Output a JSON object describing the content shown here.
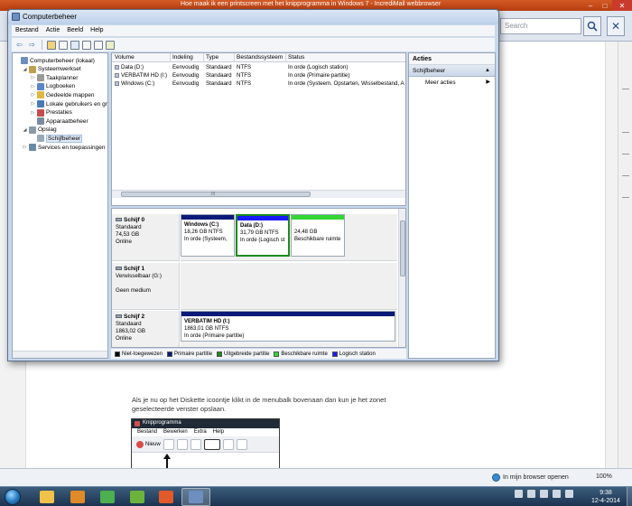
{
  "browser": {
    "title": "Hoe maak ik een printscreen met het knipprogramma in Windows 7 - IncrediMail webbrowser",
    "search_placeholder": "Search",
    "article_text": "Als je nu op het Diskette icoontje klikt in de menubalk bovenaan dan kun je het zonet geselecteerde venster opslaan.",
    "paint_window": {
      "title": "Knipprogramma",
      "menu": [
        "Bestand",
        "Bewerken",
        "Extra",
        "Help"
      ],
      "new_label": "Nieuw"
    },
    "status": {
      "protected_mode": "In mijn browser openen",
      "zoom": "100%"
    }
  },
  "taskbar": {
    "apps": [
      {
        "name": "explorer",
        "color": "#f0c24a"
      },
      {
        "name": "media-player",
        "color": "#e08a2a"
      },
      {
        "name": "chrome",
        "color": "#4caf50"
      },
      {
        "name": "utorrent",
        "color": "#6cb33e"
      },
      {
        "name": "incredimail",
        "color": "#e05a2a"
      },
      {
        "name": "computer-management",
        "color": "#6c8fbf"
      }
    ],
    "clock_time": "9:38",
    "clock_date": "12-4-2014"
  },
  "cm": {
    "title": "Computerbeheer",
    "menu": [
      "Bestand",
      "Actie",
      "Beeld",
      "Help"
    ],
    "tree": [
      {
        "label": "Computerbeheer (lokaal)",
        "indent": 0,
        "exp": "",
        "color": "#6c8fbf"
      },
      {
        "label": "Systeemwerkset",
        "indent": 1,
        "exp": "◢",
        "color": "#c0a050"
      },
      {
        "label": "Taakplanner",
        "indent": 2,
        "exp": "▷",
        "color": "#9a9a9a"
      },
      {
        "label": "Logboeken",
        "indent": 2,
        "exp": "▷",
        "color": "#5a86c8"
      },
      {
        "label": "Gedeelde mappen",
        "indent": 2,
        "exp": "▷",
        "color": "#e0b840"
      },
      {
        "label": "Lokale gebruikers en gr",
        "indent": 2,
        "exp": "▷",
        "color": "#4a7ab8"
      },
      {
        "label": "Prestaties",
        "indent": 2,
        "exp": "▷",
        "color": "#c84a4a"
      },
      {
        "label": "Apparaatbeheer",
        "indent": 2,
        "exp": "",
        "color": "#7a8aa0"
      },
      {
        "label": "Opslag",
        "indent": 1,
        "exp": "◢",
        "color": "#8a9aaa"
      },
      {
        "label": "Schijfbeheer",
        "indent": 2,
        "exp": "",
        "color": "#9aaabb",
        "selected": true
      },
      {
        "label": "Services en toepassingen",
        "indent": 1,
        "exp": "▷",
        "color": "#6a8aa8"
      }
    ],
    "volume_columns": [
      "Volume",
      "Indeling",
      "Type",
      "Bestandssysteem",
      "Status"
    ],
    "volumes": [
      [
        "Data (D:)",
        "Eenvoudig",
        "Standaard",
        "NTFS",
        "In orde (Logisch station)"
      ],
      [
        "VERBATIM HD (I:)",
        "Eenvoudig",
        "Standaard",
        "NTFS",
        "In orde (Primaire partitie)"
      ],
      [
        "Windows (C:)",
        "Eenvoudig",
        "Standaard",
        "NTFS",
        "In orde (Systeem, Opstarten, Wisselbestand, A"
      ]
    ],
    "disks": [
      {
        "name": "Schijf 0",
        "lines": [
          "Standaard",
          "74,53 GB",
          "Online"
        ],
        "partitions": [
          {
            "title": "Windows (C:)",
            "lines": [
              "18,26 GB NTFS",
              "In orde (Systeem,"
            ],
            "color": "#0a1a78"
          },
          {
            "title": "Data (D:)",
            "lines": [
              "31,79 GB NTFS",
              "In orde (Logisch st"
            ],
            "color": "#1a1aff",
            "highlight": true
          },
          {
            "title": "",
            "lines": [
              "24,48 GB",
              "Beschikbare ruimte"
            ],
            "color": "#33d633"
          }
        ]
      },
      {
        "name": "Schijf 1",
        "lines": [
          "Verwisselbaar (G:)",
          "",
          "Geen medium"
        ],
        "partitions": []
      },
      {
        "name": "Schijf 2",
        "lines": [
          "Standaard",
          "1863,02 GB",
          "Online"
        ],
        "partitions": [
          {
            "title": "VERBATIM HD (I:)",
            "lines": [
              "1863,01 GB NTFS",
              "In orde (Primaire partitie)"
            ],
            "color": "#0a1a78"
          }
        ]
      }
    ],
    "legend": [
      {
        "label": "Niet-toegewezen",
        "color": "#000000"
      },
      {
        "label": "Primaire partitie",
        "color": "#0a1a78"
      },
      {
        "label": "Uitgebreide partitie",
        "color": "#1e8a1e"
      },
      {
        "label": "Beschikbare ruimte",
        "color": "#33d633"
      },
      {
        "label": "Logisch station",
        "color": "#1a1aff"
      }
    ],
    "actions": {
      "header": "Acties",
      "section": "Schijfbeheer",
      "more": "Meer acties"
    }
  }
}
